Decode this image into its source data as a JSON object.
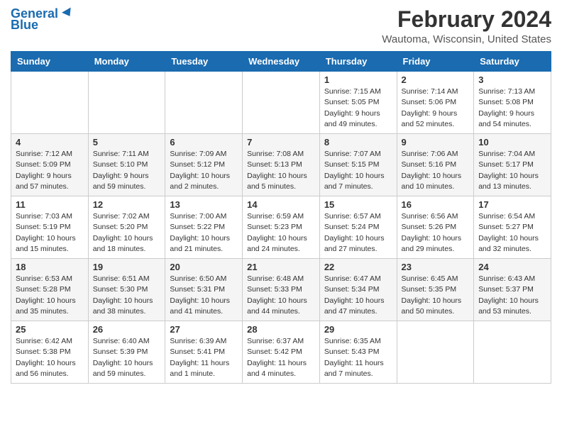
{
  "logo": {
    "line1": "General",
    "line2": "Blue"
  },
  "header": {
    "month_year": "February 2024",
    "location": "Wautoma, Wisconsin, United States"
  },
  "weekdays": [
    "Sunday",
    "Monday",
    "Tuesday",
    "Wednesday",
    "Thursday",
    "Friday",
    "Saturday"
  ],
  "weeks": [
    [
      {
        "day": "",
        "info": ""
      },
      {
        "day": "",
        "info": ""
      },
      {
        "day": "",
        "info": ""
      },
      {
        "day": "",
        "info": ""
      },
      {
        "day": "1",
        "info": "Sunrise: 7:15 AM\nSunset: 5:05 PM\nDaylight: 9 hours\nand 49 minutes."
      },
      {
        "day": "2",
        "info": "Sunrise: 7:14 AM\nSunset: 5:06 PM\nDaylight: 9 hours\nand 52 minutes."
      },
      {
        "day": "3",
        "info": "Sunrise: 7:13 AM\nSunset: 5:08 PM\nDaylight: 9 hours\nand 54 minutes."
      }
    ],
    [
      {
        "day": "4",
        "info": "Sunrise: 7:12 AM\nSunset: 5:09 PM\nDaylight: 9 hours\nand 57 minutes."
      },
      {
        "day": "5",
        "info": "Sunrise: 7:11 AM\nSunset: 5:10 PM\nDaylight: 9 hours\nand 59 minutes."
      },
      {
        "day": "6",
        "info": "Sunrise: 7:09 AM\nSunset: 5:12 PM\nDaylight: 10 hours\nand 2 minutes."
      },
      {
        "day": "7",
        "info": "Sunrise: 7:08 AM\nSunset: 5:13 PM\nDaylight: 10 hours\nand 5 minutes."
      },
      {
        "day": "8",
        "info": "Sunrise: 7:07 AM\nSunset: 5:15 PM\nDaylight: 10 hours\nand 7 minutes."
      },
      {
        "day": "9",
        "info": "Sunrise: 7:06 AM\nSunset: 5:16 PM\nDaylight: 10 hours\nand 10 minutes."
      },
      {
        "day": "10",
        "info": "Sunrise: 7:04 AM\nSunset: 5:17 PM\nDaylight: 10 hours\nand 13 minutes."
      }
    ],
    [
      {
        "day": "11",
        "info": "Sunrise: 7:03 AM\nSunset: 5:19 PM\nDaylight: 10 hours\nand 15 minutes."
      },
      {
        "day": "12",
        "info": "Sunrise: 7:02 AM\nSunset: 5:20 PM\nDaylight: 10 hours\nand 18 minutes."
      },
      {
        "day": "13",
        "info": "Sunrise: 7:00 AM\nSunset: 5:22 PM\nDaylight: 10 hours\nand 21 minutes."
      },
      {
        "day": "14",
        "info": "Sunrise: 6:59 AM\nSunset: 5:23 PM\nDaylight: 10 hours\nand 24 minutes."
      },
      {
        "day": "15",
        "info": "Sunrise: 6:57 AM\nSunset: 5:24 PM\nDaylight: 10 hours\nand 27 minutes."
      },
      {
        "day": "16",
        "info": "Sunrise: 6:56 AM\nSunset: 5:26 PM\nDaylight: 10 hours\nand 29 minutes."
      },
      {
        "day": "17",
        "info": "Sunrise: 6:54 AM\nSunset: 5:27 PM\nDaylight: 10 hours\nand 32 minutes."
      }
    ],
    [
      {
        "day": "18",
        "info": "Sunrise: 6:53 AM\nSunset: 5:28 PM\nDaylight: 10 hours\nand 35 minutes."
      },
      {
        "day": "19",
        "info": "Sunrise: 6:51 AM\nSunset: 5:30 PM\nDaylight: 10 hours\nand 38 minutes."
      },
      {
        "day": "20",
        "info": "Sunrise: 6:50 AM\nSunset: 5:31 PM\nDaylight: 10 hours\nand 41 minutes."
      },
      {
        "day": "21",
        "info": "Sunrise: 6:48 AM\nSunset: 5:33 PM\nDaylight: 10 hours\nand 44 minutes."
      },
      {
        "day": "22",
        "info": "Sunrise: 6:47 AM\nSunset: 5:34 PM\nDaylight: 10 hours\nand 47 minutes."
      },
      {
        "day": "23",
        "info": "Sunrise: 6:45 AM\nSunset: 5:35 PM\nDaylight: 10 hours\nand 50 minutes."
      },
      {
        "day": "24",
        "info": "Sunrise: 6:43 AM\nSunset: 5:37 PM\nDaylight: 10 hours\nand 53 minutes."
      }
    ],
    [
      {
        "day": "25",
        "info": "Sunrise: 6:42 AM\nSunset: 5:38 PM\nDaylight: 10 hours\nand 56 minutes."
      },
      {
        "day": "26",
        "info": "Sunrise: 6:40 AM\nSunset: 5:39 PM\nDaylight: 10 hours\nand 59 minutes."
      },
      {
        "day": "27",
        "info": "Sunrise: 6:39 AM\nSunset: 5:41 PM\nDaylight: 11 hours\nand 1 minute."
      },
      {
        "day": "28",
        "info": "Sunrise: 6:37 AM\nSunset: 5:42 PM\nDaylight: 11 hours\nand 4 minutes."
      },
      {
        "day": "29",
        "info": "Sunrise: 6:35 AM\nSunset: 5:43 PM\nDaylight: 11 hours\nand 7 minutes."
      },
      {
        "day": "",
        "info": ""
      },
      {
        "day": "",
        "info": ""
      }
    ]
  ]
}
